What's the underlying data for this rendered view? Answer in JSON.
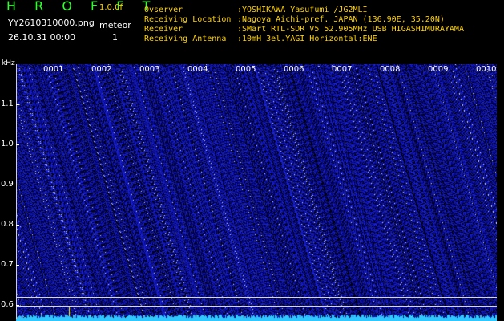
{
  "header": {
    "brand": "H R O F F T",
    "version": "1.0.0f",
    "filename": "YY2610310000.png",
    "datetime": "26.10.31 00:00",
    "meteor_label": "meteor",
    "meteor_count": "1"
  },
  "info": [
    {
      "key": "Ovserver",
      "value": ":YOSHIKAWA Yasufumi /JG2MLI"
    },
    {
      "key": "Receiving Location",
      "value": ":Nagoya Aichi-pref. JAPAN (136.90E, 35.20N)"
    },
    {
      "key": "Receiver",
      "value": ":SMart RTL-SDR V5 52.905MHz USB HIGASHIMURAYAMA"
    },
    {
      "key": "Receiving Antenna",
      "value": ":10mH 3el.YAGI Horizontal:ENE"
    }
  ],
  "axis": {
    "y_unit": "kHz",
    "y_ticks": [
      "1.1",
      "1.0",
      "0.9",
      "0.8",
      "0.7",
      "0.6"
    ],
    "x_ticks": [
      "0001",
      "0002",
      "0003",
      "0004",
      "0005",
      "0006",
      "0007",
      "0008",
      "0009",
      "0010"
    ]
  },
  "colors": {
    "brand": "#2cff2c",
    "info_text": "#ffd200",
    "background": "#000000",
    "noise_blue": "#1a24c8",
    "spectrum": "#2ec8ff",
    "meteor": "#ffff00"
  }
}
